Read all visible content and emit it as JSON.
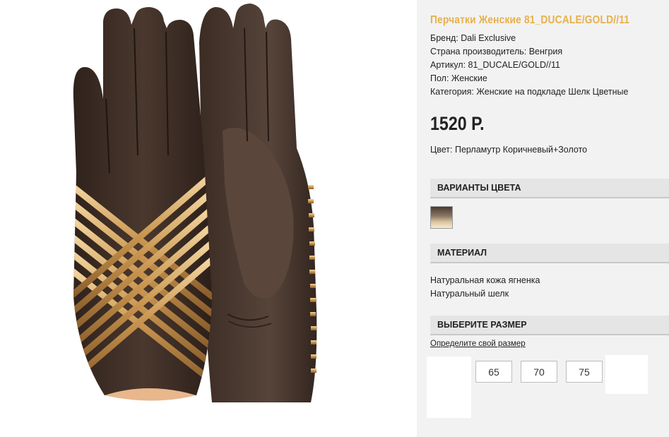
{
  "product": {
    "title": "Перчатки Женские 81_DUCALE/GOLD//11",
    "specs": [
      "Бренд: Dali Exclusive",
      "Страна производитель: Венгрия",
      "Артикул: 81_DUCALE/GOLD//11",
      "Пол: Женские",
      "Категория: Женские на подкладе Шелк Цветные"
    ],
    "price": "1520 Р.",
    "color": "Цвет: Перламутр Коричневый+Золото"
  },
  "sections": {
    "color_variants": "ВАРИАНТЫ ЦВЕТА",
    "material": "МАТЕРИАЛ",
    "size": "ВЫБЕРИТЕ РАЗМЕР"
  },
  "materials": [
    "Натуральная кожа ягненка",
    "Натуральный шелк"
  ],
  "size_link": "Определите свой размер",
  "sizes": [
    "65",
    "70",
    "75"
  ],
  "colors": {
    "title_accent": "#e8b04a",
    "panel_bg": "#f2f2f2",
    "glove_leather": "#3f2e26",
    "gold_stripe": "#d6a868"
  }
}
